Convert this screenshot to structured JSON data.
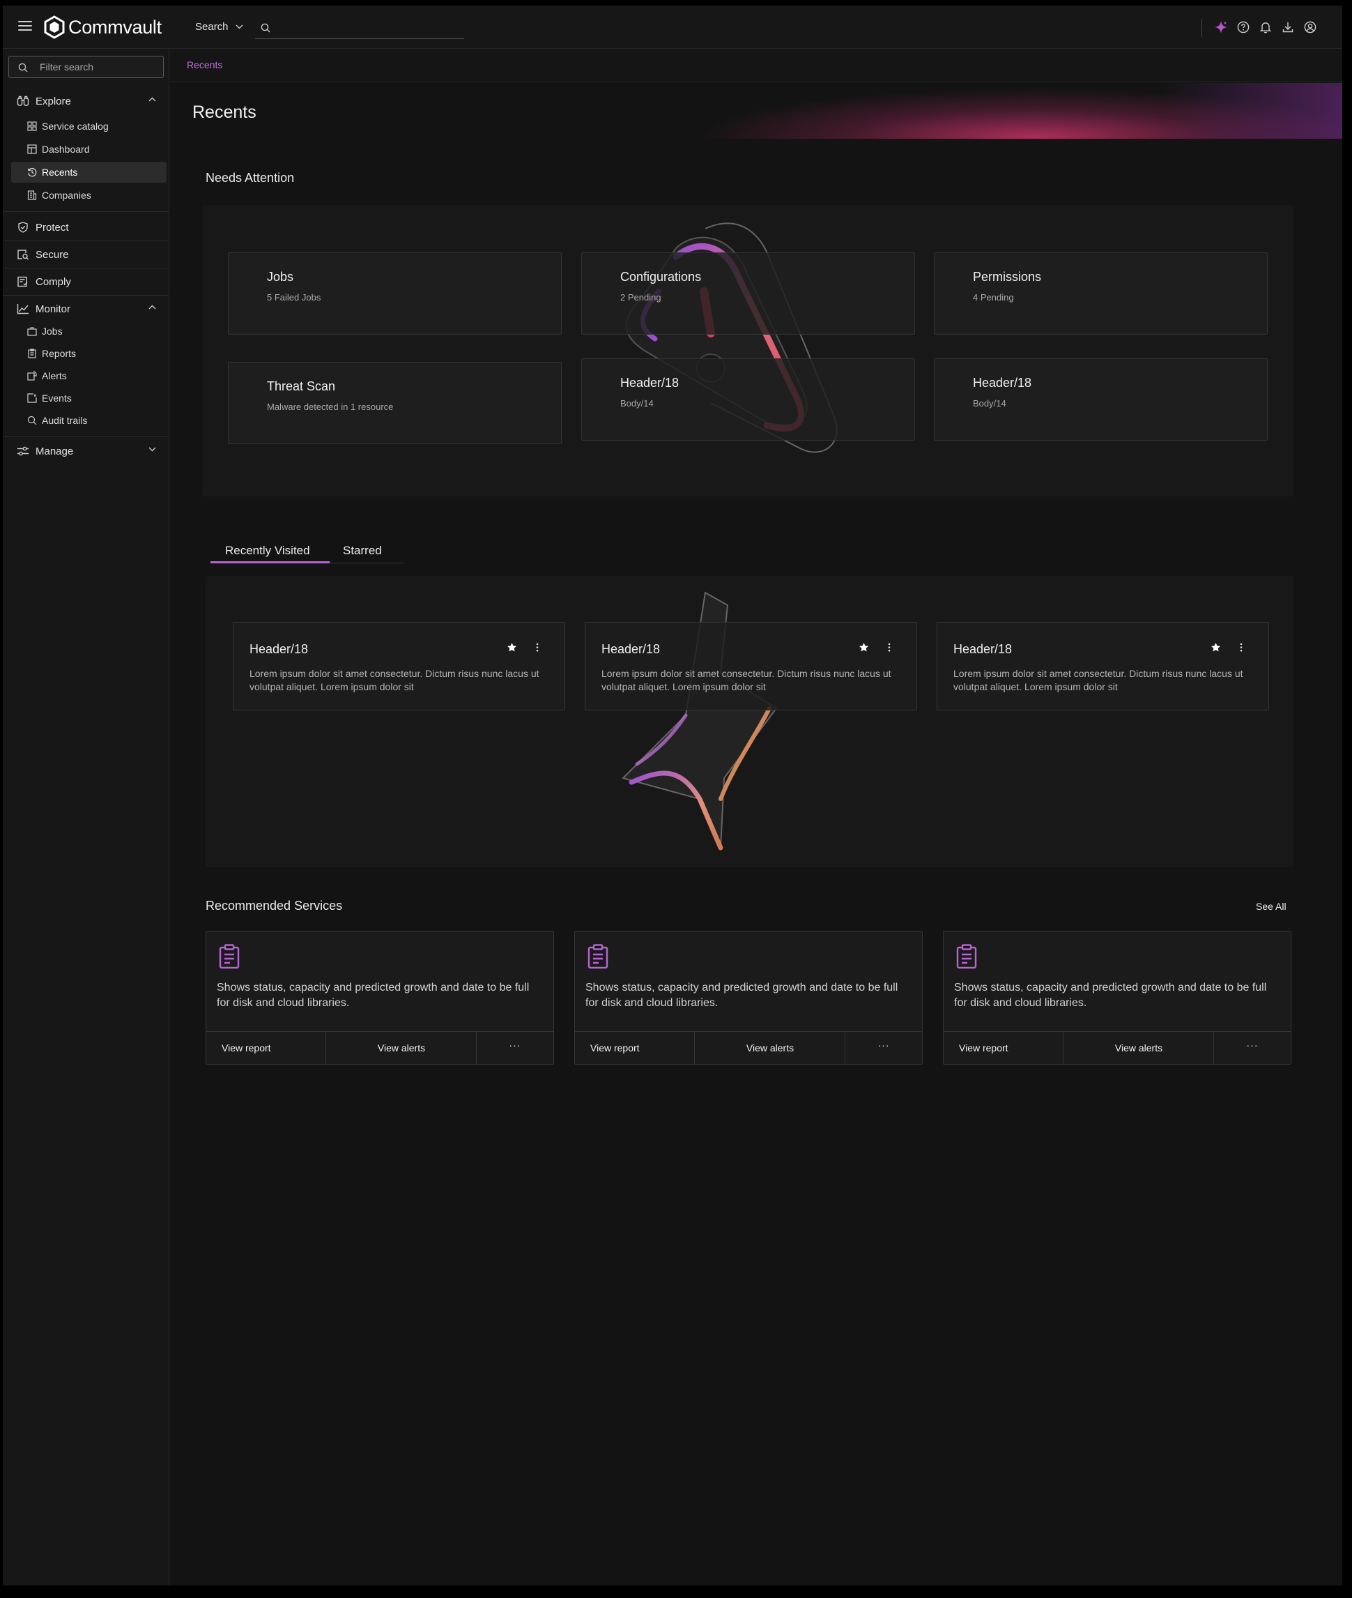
{
  "topbar": {
    "logo_text": "Commvault",
    "search_scope": "Search",
    "search_placeholder": ""
  },
  "sidebar": {
    "filter_placeholder": "Filter search",
    "sections": {
      "explore": "Explore",
      "protect": "Protect",
      "secure": "Secure",
      "comply": "Comply",
      "monitor": "Monitor",
      "manage": "Manage"
    },
    "explore_items": [
      "Service catalog",
      "Dashboard",
      "Recents",
      "Companies"
    ],
    "monitor_items": [
      "Jobs",
      "Reports",
      "Alerts",
      "Events",
      "Audit trails"
    ],
    "active_item": "Recents"
  },
  "breadcrumb": "Recents",
  "page_title": "Recents",
  "needs_attention": {
    "title": "Needs Attention",
    "cards": [
      {
        "header": "Jobs",
        "body": "5 Failed Jobs"
      },
      {
        "header": "Configurations",
        "body": "2 Pending"
      },
      {
        "header": "Permissions",
        "body": "4 Pending"
      },
      {
        "header": "Threat Scan",
        "body": "Malware detected in 1 resource"
      },
      {
        "header": "Header/18",
        "body": "Body/14"
      },
      {
        "header": "Header/18",
        "body": "Body/14"
      }
    ]
  },
  "tabs": [
    "Recently Visited",
    "Starred"
  ],
  "recently_visited": [
    {
      "header": "Header/18",
      "body": "Lorem ipsum dolor sit amet consectetur. Dictum risus nunc lacus ut volutpat aliquet. Lorem ipsum dolor sit"
    },
    {
      "header": "Header/18",
      "body": "Lorem ipsum dolor sit amet consectetur. Dictum risus nunc lacus ut volutpat aliquet. Lorem ipsum dolor sit"
    },
    {
      "header": "Header/18",
      "body": "Lorem ipsum dolor sit amet consectetur. Dictum risus nunc lacus ut volutpat aliquet. Lorem ipsum dolor sit"
    }
  ],
  "recommended": {
    "title": "Recommended Services",
    "see_all": "See All",
    "cards": [
      {
        "desc": "Shows status, capacity and predicted growth and date to be full for disk and cloud libraries.",
        "action1": "View report",
        "action2": "View alerts",
        "more": "···"
      },
      {
        "desc": "Shows status, capacity and predicted growth and date to be full for disk and cloud libraries.",
        "action1": "View report",
        "action2": "View alerts",
        "more": "···"
      },
      {
        "desc": "Shows status, capacity and predicted growth and date to be full for disk and cloud libraries.",
        "action1": "View report",
        "action2": "View alerts",
        "more": "···"
      }
    ]
  },
  "colors": {
    "accent": "#b864d4",
    "background": "#131313",
    "card": "#202020",
    "gradient_pink": "#d6346e"
  },
  "icons": {
    "topbar": [
      "menu-icon",
      "search-icon",
      "ai-sparkle-icon",
      "help-icon",
      "bell-icon",
      "download-icon",
      "user-icon"
    ]
  }
}
